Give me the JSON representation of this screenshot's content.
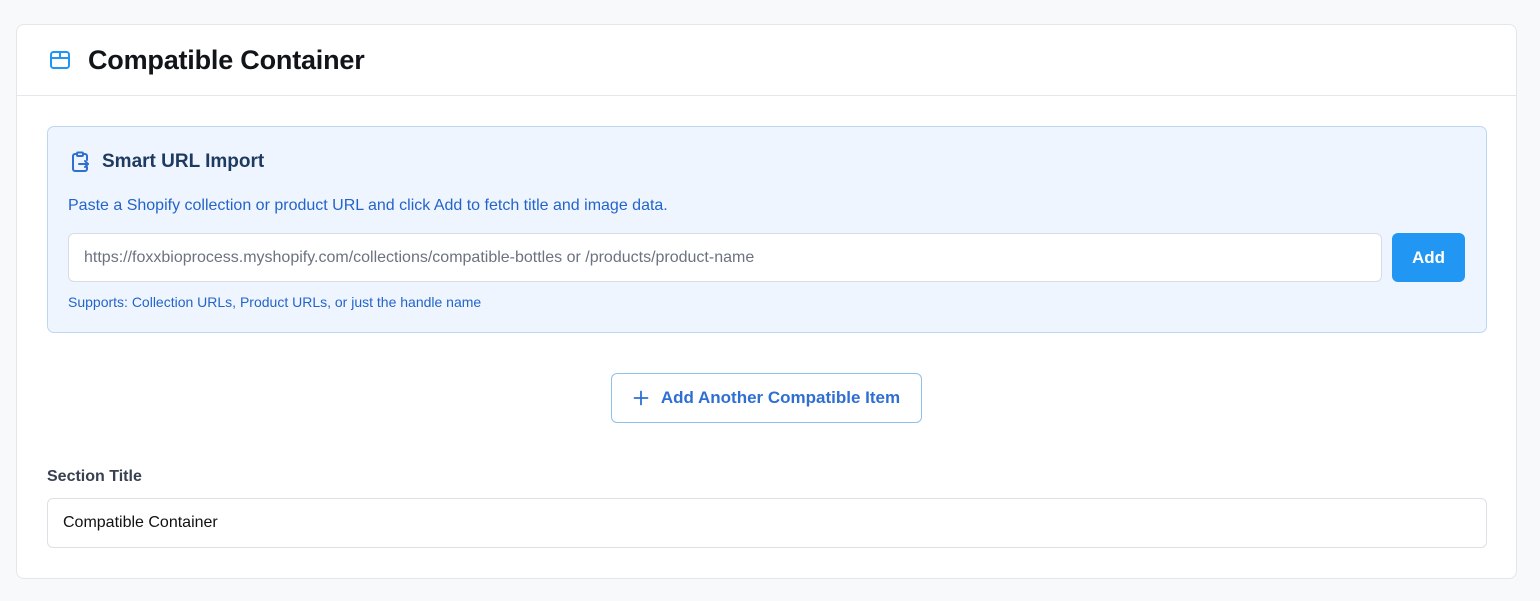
{
  "header": {
    "icon": "package-icon",
    "title": "Compatible Container"
  },
  "import": {
    "icon": "clipboard-import-icon",
    "title": "Smart URL Import",
    "description": "Paste a Shopify collection or product URL and click Add to fetch title and image data.",
    "url_placeholder": "https://foxxbioprocess.myshopify.com/collections/compatible-bottles or /products/product-name",
    "url_value": "",
    "add_label": "Add",
    "supports_text": "Supports: Collection URLs, Product URLs, or just the handle name"
  },
  "add_item": {
    "icon": "plus-icon",
    "label": "Add Another Compatible Item"
  },
  "section_title": {
    "label": "Section Title",
    "value": "Compatible Container"
  },
  "colors": {
    "accent": "#2196f3",
    "import_bg": "#eef5ff",
    "link_blue": "#2464c9"
  }
}
